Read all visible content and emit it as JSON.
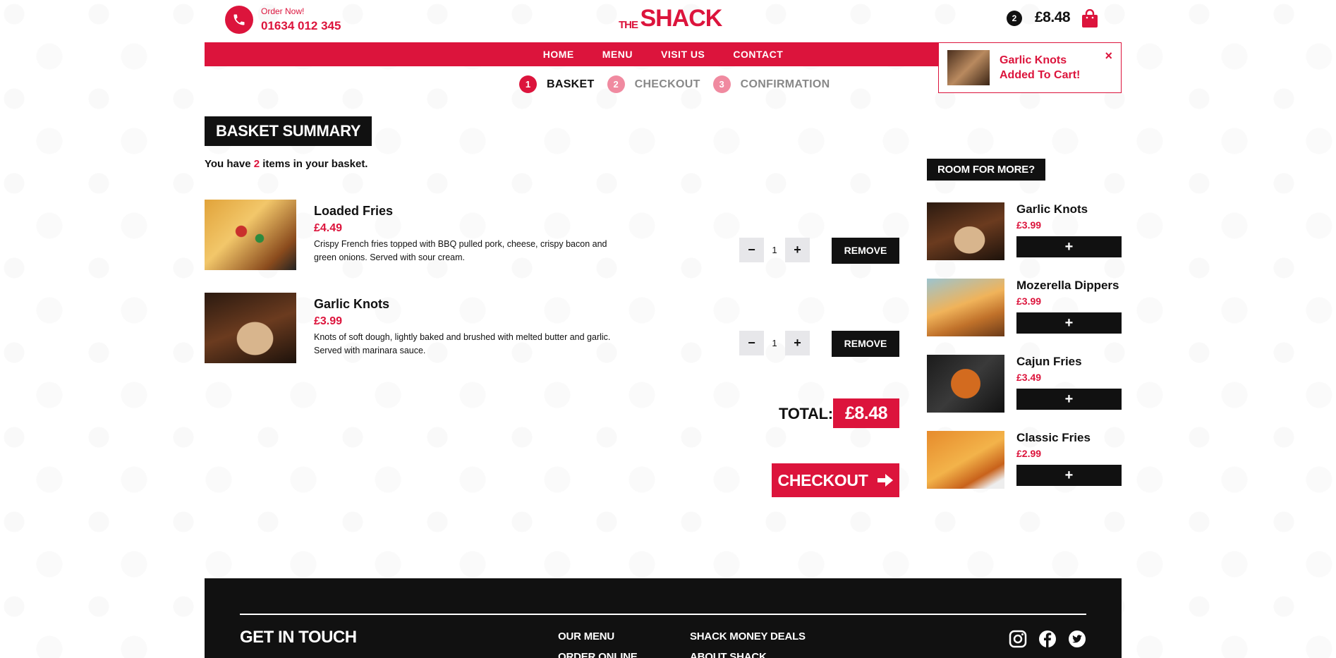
{
  "header": {
    "order_now": "Order Now!",
    "phone": "01634 012 345",
    "logo_the": "THE",
    "logo_shack": "SHACK",
    "cart_count": "2",
    "cart_total": "£8.48"
  },
  "nav": {
    "items": [
      {
        "label": "HOME"
      },
      {
        "label": "MENU"
      },
      {
        "label": "VISIT US"
      },
      {
        "label": "CONTACT"
      }
    ]
  },
  "toast": {
    "line1": "Garlic Knots",
    "line2": "Added To Cart!",
    "close": "×"
  },
  "steps": [
    {
      "num": "1",
      "label": "BASKET"
    },
    {
      "num": "2",
      "label": "CHECKOUT"
    },
    {
      "num": "3",
      "label": "CONFIRMATION"
    }
  ],
  "basket": {
    "title": "BASKET SUMMARY",
    "count_prefix": "You have ",
    "count": "2",
    "count_suffix": " items in your basket.",
    "items": [
      {
        "name": "Loaded Fries",
        "price": "£4.49",
        "desc": "Crispy French fries topped with BBQ pulled pork, cheese, crispy bacon and green onions. Served with sour cream.",
        "qty": "1",
        "minus": "−",
        "plus": "+",
        "remove": "REMOVE"
      },
      {
        "name": "Garlic Knots",
        "price": "£3.99",
        "desc": "Knots of soft dough, lightly baked and brushed with melted butter and garlic. Served with marinara sauce.",
        "qty": "1",
        "minus": "−",
        "plus": "+",
        "remove": "REMOVE"
      }
    ],
    "total_label": "TOTAL:",
    "total": "£8.48",
    "checkout": "CHECKOUT"
  },
  "upsell": {
    "title": "ROOM FOR MORE?",
    "items": [
      {
        "name": "Garlic Knots",
        "price": "£3.99",
        "add": "+"
      },
      {
        "name": "Mozerella Dippers",
        "price": "£3.99",
        "add": "+"
      },
      {
        "name": "Cajun Fries",
        "price": "£3.49",
        "add": "+"
      },
      {
        "name": "Classic Fries",
        "price": "£2.99",
        "add": "+"
      }
    ]
  },
  "footer": {
    "title": "GET IN TOUCH",
    "links": [
      "OUR MENU",
      "ORDER ONLINE",
      "SHACK MONEY DEALS",
      "ABOUT SHACK"
    ]
  },
  "colors": {
    "brand_red": "#dc143c",
    "dark": "#111111"
  }
}
